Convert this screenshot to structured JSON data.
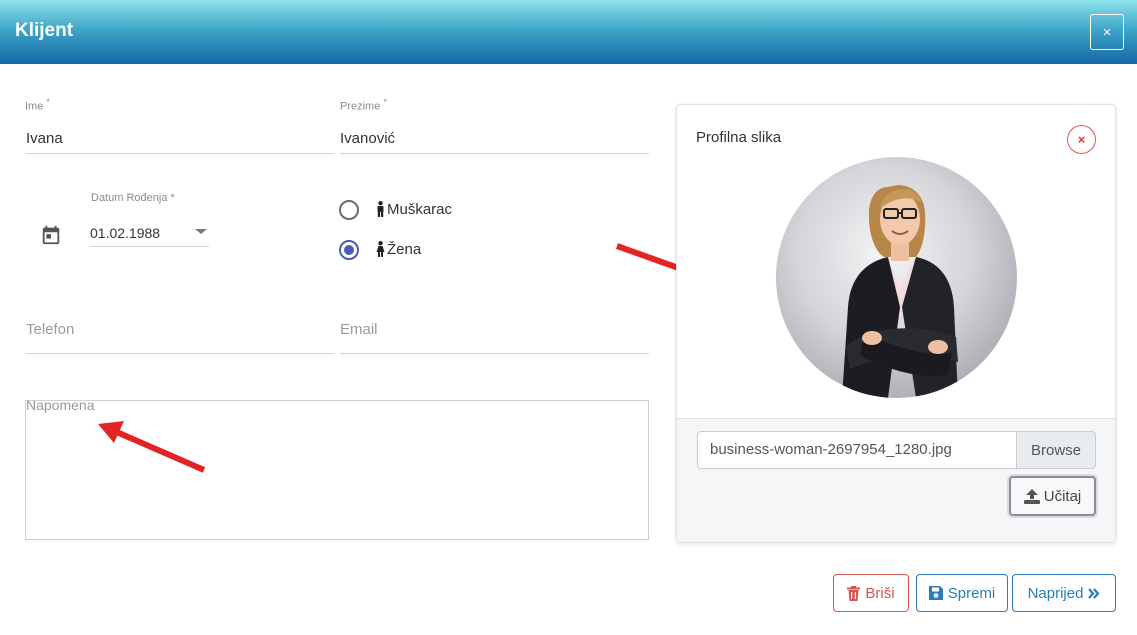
{
  "header": {
    "title": "Klijent",
    "close_glyph": "×"
  },
  "form": {
    "first_name": {
      "label": "Ime",
      "required": "*",
      "value": "Ivana"
    },
    "last_name": {
      "label": "Prezime",
      "required": "*",
      "value": "Ivanović"
    },
    "birth_date": {
      "label": "Datum Rođenja",
      "required": "*",
      "value": "01.02.1988"
    },
    "gender": {
      "options": [
        {
          "label": "Muškarac",
          "checked": false
        },
        {
          "label": "Žena",
          "checked": true
        }
      ]
    },
    "phone": {
      "placeholder": "Telefon"
    },
    "email": {
      "placeholder": "Email"
    },
    "note": {
      "placeholder": "Napomena"
    }
  },
  "profile_card": {
    "title": "Profilna slika",
    "close_glyph": "×",
    "file_name": "business-woman-2697954_1280.jpg",
    "browse_label": "Browse",
    "upload_label": "Učitaj"
  },
  "actions": {
    "delete_label": "Briši",
    "save_label": "Spremi",
    "next_label": "Naprijed"
  },
  "colors": {
    "header_top": "#8ee3ea",
    "header_bottom": "#1468a8",
    "radio_accent": "#4a5ab5",
    "danger": "#d9534f",
    "primary": "#2a7db8",
    "annotation_arrow": "#e22424"
  },
  "icons": {
    "calendar": "calendar-icon",
    "male": "male-icon",
    "female": "female-icon",
    "trash": "trash-icon",
    "save": "save-icon",
    "next": "double-chevron-right-icon",
    "upload": "upload-icon"
  }
}
